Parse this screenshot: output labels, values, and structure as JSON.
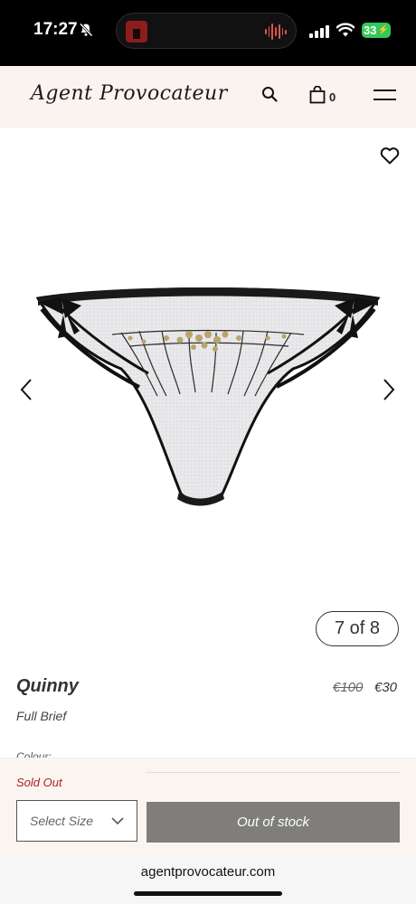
{
  "status_bar": {
    "time": "17:27",
    "battery": "33",
    "icons": [
      "bell-slash-icon",
      "cellular-signal-icon",
      "wifi-icon",
      "battery-charging-icon"
    ]
  },
  "header": {
    "logo": "Agent Provocateur",
    "bag_count": "0",
    "icons": [
      "search-icon",
      "shopping-bag-icon",
      "hamburger-menu-icon"
    ]
  },
  "gallery": {
    "counter": "7 of 8",
    "icons": [
      "heart-icon",
      "chevron-left-icon",
      "chevron-right-icon"
    ]
  },
  "product": {
    "name": "Quinny",
    "type": "Full Brief",
    "price_original": "€100",
    "price_sale": "€30",
    "colour_label": "Colour:"
  },
  "purchase": {
    "status": "Sold Out",
    "size_placeholder": "Select Size",
    "button_label": "Out of stock"
  },
  "browser": {
    "url": "agentprovocateur.com"
  },
  "colors": {
    "header_bg": "#fbf3f0",
    "sold_out": "#b02020",
    "button_bg": "#7f7e7b",
    "battery": "#34c759"
  }
}
